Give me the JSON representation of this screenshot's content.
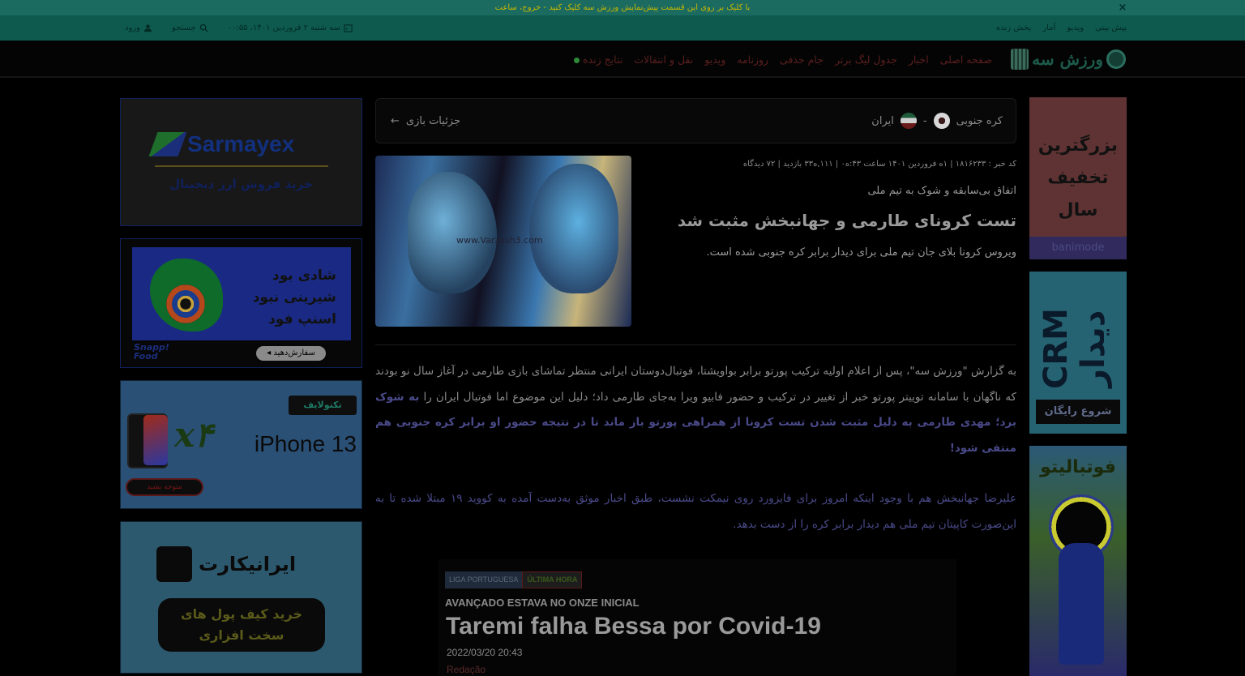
{
  "notice": {
    "text": "با کلیک بر روی این قسمت پیش‌نمایش ورزش سه کلیک کنید - خروج، ساعت",
    "close_glyph": "×"
  },
  "topbar": {
    "links": [
      "پیش بینی",
      "ویدیو",
      "آمار",
      "پخش زنده"
    ],
    "date": "سه شنبه ۲ فروردین ۱۴۰۱، ۰۰:۵۵",
    "search": "جستجو",
    "login": "ورود"
  },
  "logo": {
    "text": "ورزش سه"
  },
  "nav": {
    "items": [
      "صفحه اصلی",
      "اخبار",
      "جدول لیگ برتر",
      "جام حذفی",
      "روزنامه",
      "ویدیو",
      "نقل و انتقالات",
      "نتایج زنده"
    ]
  },
  "ads": {
    "sarmayex": {
      "brand": "Sarmayex",
      "sub": "خرید فروش ارز دیجیتال"
    },
    "snapp": {
      "line1": "شادی بود",
      "line2": "شیرینی نبود",
      "line3": "اسنپ فود",
      "brand1": "Snapp!",
      "brand2": "Food",
      "button": "سفارش‌دهید ◂"
    },
    "iphone": {
      "brand": "تکنولایف",
      "x4": "x۴",
      "model": "iPhone 13",
      "button": "متوجه بشید"
    },
    "iranicard": {
      "brand": "ایرانیکارت",
      "btn1": "خرید کیف پول های",
      "btn2": "سخت افزاری"
    },
    "right1": {
      "line1": "بزرگترین",
      "line2": "تخفیف",
      "line3": "سال",
      "foot": "banimode"
    },
    "right2": {
      "text": "CRM دیدار",
      "button": "شروع رایگان"
    },
    "right3": {
      "title": "فوتبالیتو"
    }
  },
  "match": {
    "home": "کره جنوبی",
    "separator": "-",
    "away": "ایران",
    "link": "جزئیات بازی",
    "arrow": "←"
  },
  "article": {
    "meta": "کد خبر : ۱۸۱۶۲۳۳ | ۱ه فروردین ۱۴۰۱ ساعت ۴۳:ه۰ | ۱۱۱,ه۳۳ بازدید | ۷۲ دیدگاه",
    "kicker": "اتفاق بی‌سابقه و شوک به تیم ملی",
    "title": "تست کرونای طارمی و جهانبخش مثبت شد",
    "lead": "ویروس کرونا بلای جان تیم ملی برای دیدار برابر کره جنوبی شده است.",
    "watermark": "www.Varzesh3.com",
    "p1_a": "به گزارش \"ورزش سه\"، پس از اعلام اولیه ترکیب پورتو برابر بواویشتا، فوتبال‌دوستان ایرانی منتظر تماشای بازی طارمی در آغاز سال نو بودند که ناگهان با سامانه توییتر پورتو خبر از تغییر در ترکیب و حضور فابیو ویرا به‌جای طارمی داد؛ دلیل این موضوع اما فوتبال ایران را",
    "p1_b": "به شوک برد؛ مهدی طارمی به دلیل مثبت شدن تست کرونا از همراهی پورتو باز ماند تا در نتیجه حضور او برابر کره جنوبی هم منتفی شود!",
    "p2": "علیرضا جهانبخش هم با وجود اینکه امروز برای فایزورد روی نیمکت نشست، طبق اخبار موثق به‌دست آمده به کووید ۱۹ مبتلا شده تا به این‌صورت کاپیتان تیم ملی هم دیدار برابر کره را از دست بدهد."
  },
  "embed": {
    "tag1": "LIGA PORTUGUESA",
    "tag2": "ÚLTIMA HORA",
    "kicker": "AVANÇADO ESTAVA NO ONZE INICIAL",
    "title": "Taremi falha Bessa por Covid-19",
    "date": "2022/03/20 20:43",
    "author": "Redação"
  }
}
